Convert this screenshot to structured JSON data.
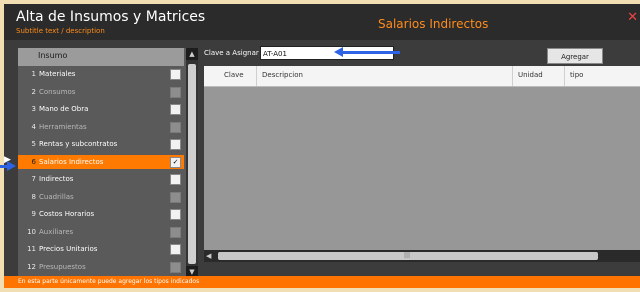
{
  "window": {
    "title": "Alta de Insumos y Matrices",
    "subtitle": "Subtitle text / description",
    "module_title": "Salarios Indirectos",
    "close_glyph": "✕"
  },
  "list": {
    "header": "Insumo",
    "items": [
      {
        "num": "1",
        "label": "Materiales",
        "checked": true,
        "dim": false
      },
      {
        "num": "2",
        "label": "Consumos",
        "checked": false,
        "dim": true
      },
      {
        "num": "3",
        "label": "Mano de Obra",
        "checked": true,
        "dim": false
      },
      {
        "num": "4",
        "label": "Herramientas",
        "checked": false,
        "dim": true
      },
      {
        "num": "5",
        "label": "Rentas y subcontratos",
        "checked": true,
        "dim": false
      },
      {
        "num": "6",
        "label": "Salarios Indirectos",
        "checked": true,
        "dim": false,
        "selected": true
      },
      {
        "num": "7",
        "label": "Indirectos",
        "checked": true,
        "dim": false
      },
      {
        "num": "8",
        "label": "Cuadrillas",
        "checked": false,
        "dim": true
      },
      {
        "num": "9",
        "label": "Costos Horarios",
        "checked": true,
        "dim": false
      },
      {
        "num": "10",
        "label": "Auxiliares",
        "checked": false,
        "dim": true
      },
      {
        "num": "11",
        "label": "Precios Unitarios",
        "checked": true,
        "dim": false
      },
      {
        "num": "12",
        "label": "Presupuestos",
        "checked": false,
        "dim": true
      }
    ]
  },
  "form": {
    "key_label": "Clave a Asignar",
    "key_value": "AT-A01",
    "add_label": "Agregar"
  },
  "grid": {
    "columns": [
      "Clave",
      "Descripcion",
      "Unidad",
      "tipo"
    ]
  },
  "status": {
    "message": "En esta parte únicamente puede agregar los tipos indicados"
  },
  "colors": {
    "accent": "#ff7a00",
    "annotation_arrow": "#2f63e6"
  }
}
